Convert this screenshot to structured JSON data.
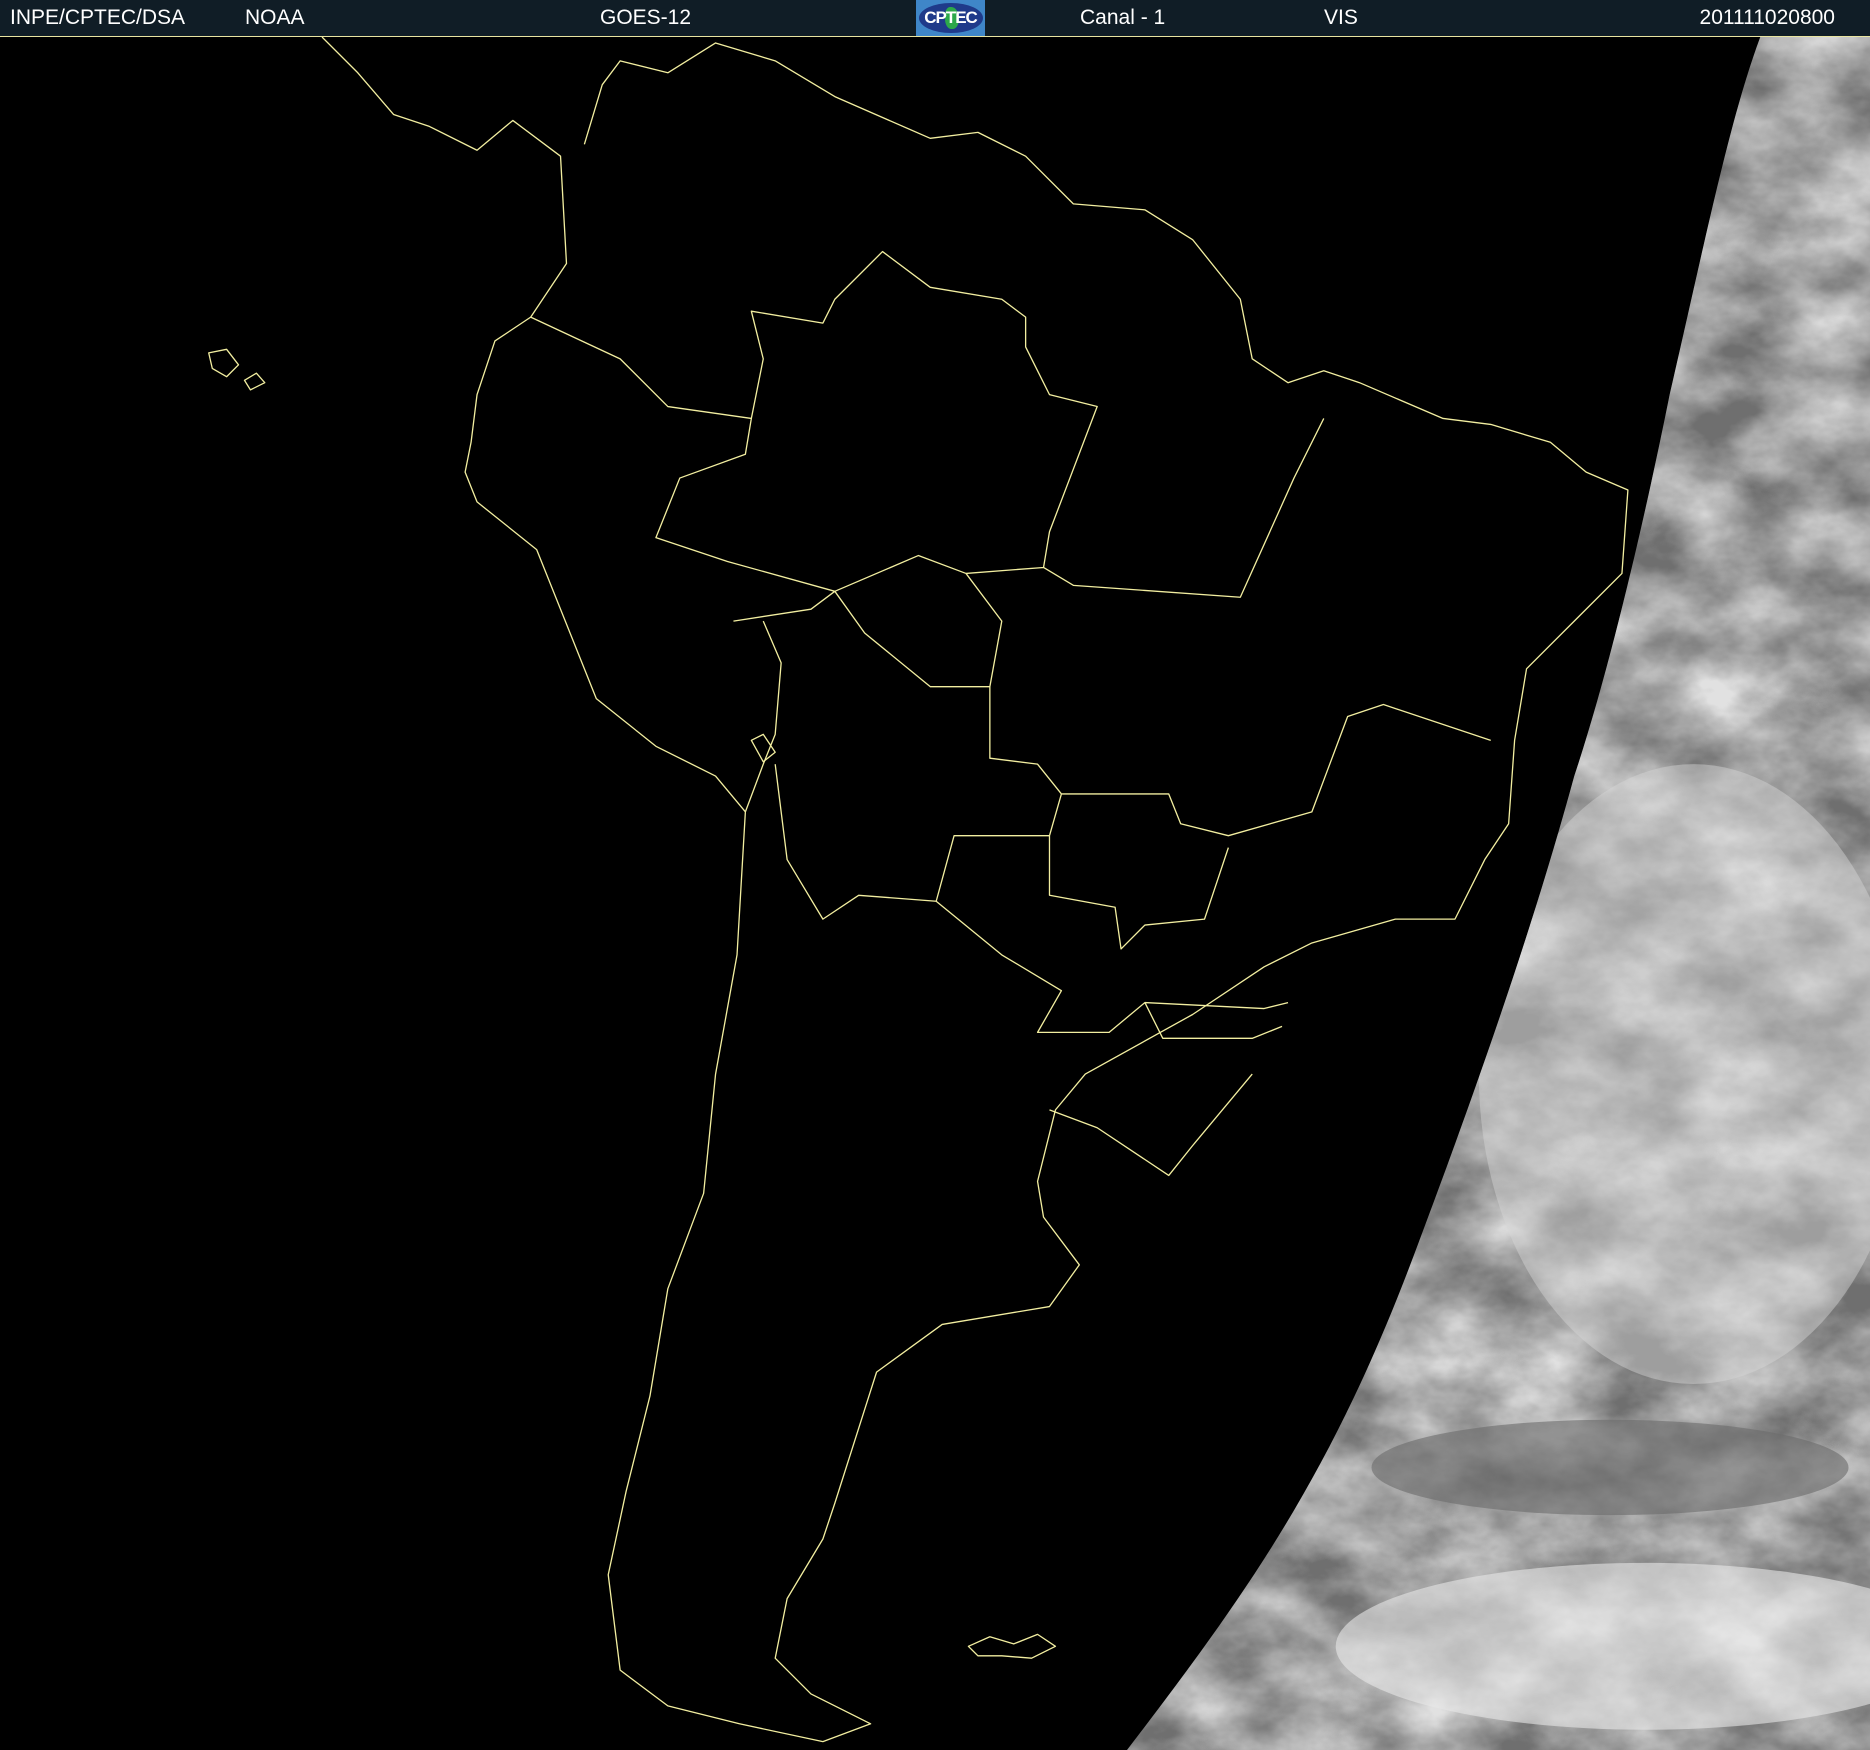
{
  "header": {
    "institution": "INPE/CPTEC/DSA",
    "agency": "NOAA",
    "satellite": "GOES-12",
    "logo_text": "CPTEC",
    "channel": "Canal - 1",
    "band": "VIS",
    "timestamp": "201111020800"
  },
  "colors": {
    "header_bg": "#101d26",
    "border_lines": "#f2eea0",
    "background": "#000000",
    "clouds": "#bfbfbf"
  }
}
